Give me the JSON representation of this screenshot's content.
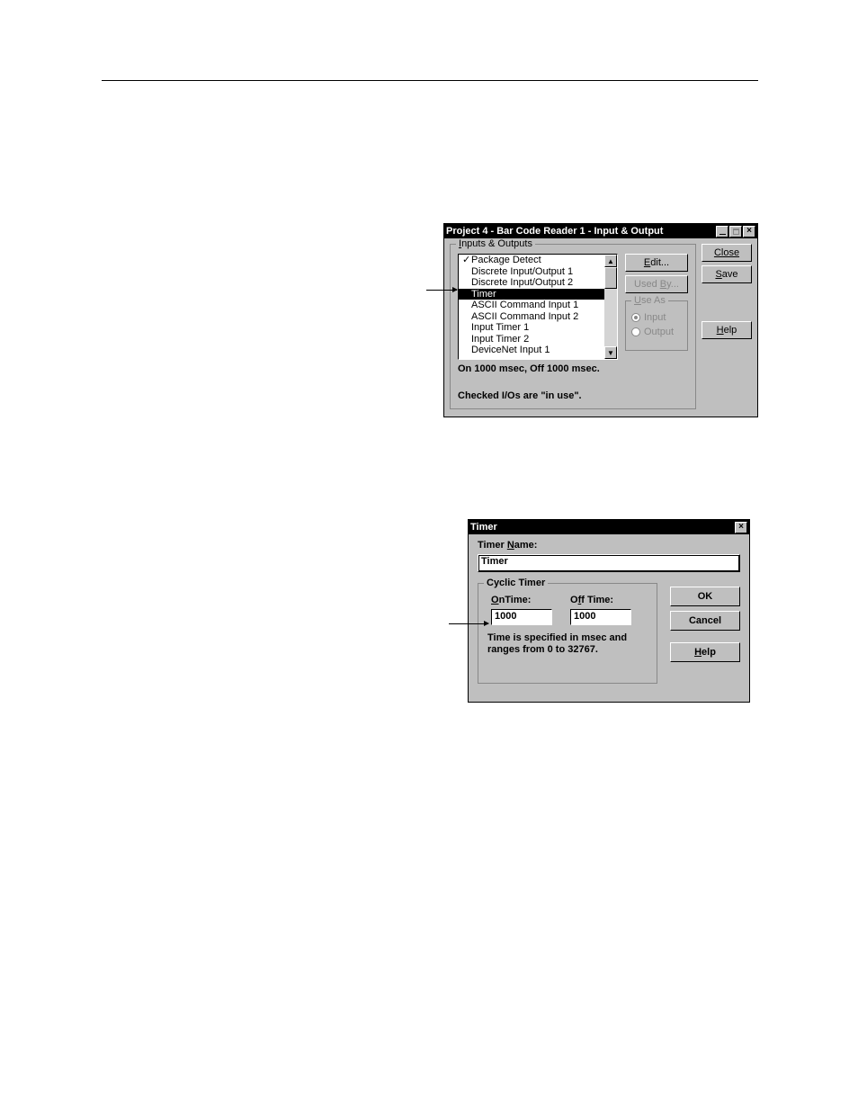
{
  "dlg1": {
    "title": "Project 4 - Bar Code Reader 1 - Input & Output",
    "group_label": "Inputs & Outputs",
    "items": [
      {
        "checked": true,
        "label": "Package Detect",
        "selected": false
      },
      {
        "checked": false,
        "label": "Discrete Input/Output 1",
        "selected": false
      },
      {
        "checked": false,
        "label": "Discrete Input/Output 2",
        "selected": false
      },
      {
        "checked": false,
        "label": "Timer",
        "selected": true
      },
      {
        "checked": false,
        "label": "ASCII Command Input 1",
        "selected": false
      },
      {
        "checked": false,
        "label": "ASCII Command Input 2",
        "selected": false
      },
      {
        "checked": false,
        "label": "Input Timer 1",
        "selected": false
      },
      {
        "checked": false,
        "label": "Input Timer 2",
        "selected": false
      },
      {
        "checked": false,
        "label": "DeviceNet Input 1",
        "selected": false
      }
    ],
    "status1": "On 1000 msec, Off 1000 msec.",
    "status2": "Checked I/Os are \"in use\".",
    "edit_btn": "Edit...",
    "usedby_btn": "Used By...",
    "useas_label": "Use As",
    "radio_input": "Input",
    "radio_output": "Output",
    "close_btn": "Close",
    "save_btn": "Save",
    "help_btn": "Help"
  },
  "dlg2": {
    "title": "Timer",
    "name_label": "Timer Name:",
    "name_value": "Timer",
    "cyclic_label": "Cyclic Timer",
    "ontime_label": "OnTime:",
    "offtime_label": "Off Time:",
    "ontime_value": "1000",
    "offtime_value": "1000",
    "hint": "Time is specified in msec and ranges from 0 to 32767.",
    "ok_btn": "OK",
    "cancel_btn": "Cancel",
    "help_btn": "Help"
  }
}
